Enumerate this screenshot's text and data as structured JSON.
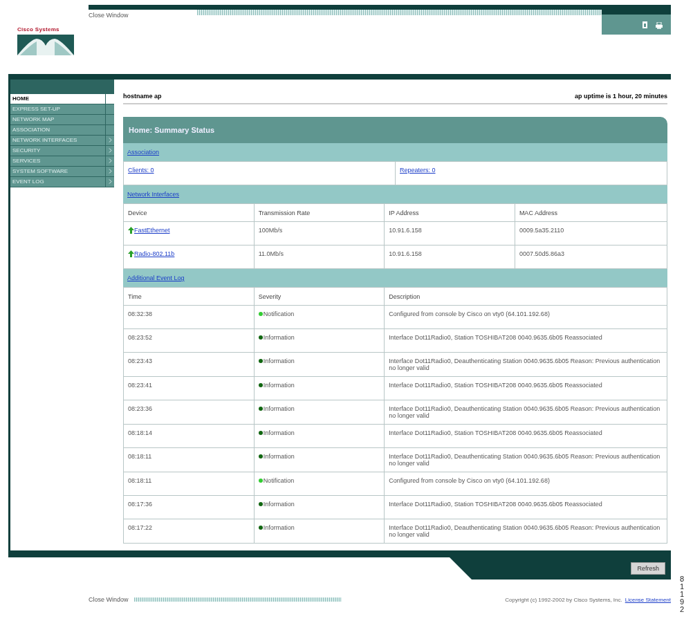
{
  "header": {
    "close_window": "Close Window",
    "brand": "Cisco Systems"
  },
  "sidebar": [
    {
      "label": "HOME",
      "selected": true,
      "has_submenu": false
    },
    {
      "label": "EXPRESS SET-UP",
      "selected": false,
      "has_submenu": false
    },
    {
      "label": "NETWORK MAP",
      "selected": false,
      "has_submenu": false
    },
    {
      "label": "ASSOCIATION",
      "selected": false,
      "has_submenu": false
    },
    {
      "label": "NETWORK INTERFACES",
      "selected": false,
      "has_submenu": true
    },
    {
      "label": "SECURITY",
      "selected": false,
      "has_submenu": true
    },
    {
      "label": "SERVICES",
      "selected": false,
      "has_submenu": true
    },
    {
      "label": "SYSTEM SOFTWARE",
      "selected": false,
      "has_submenu": true
    },
    {
      "label": "EVENT LOG",
      "selected": false,
      "has_submenu": true
    }
  ],
  "status": {
    "hostname": "hostname ap",
    "uptime": "ap uptime is 1 hour, 20 minutes"
  },
  "panel": {
    "title": "Home: Summary Status",
    "association": {
      "link": "Association",
      "cells": [
        "Clients: 0",
        "Repeaters: 0"
      ]
    },
    "interfaces": {
      "link": "Network Interfaces",
      "columns": [
        "Device",
        "Transmission Rate",
        "IP Address",
        "MAC Address"
      ],
      "rows": [
        {
          "device": "FastEthernet",
          "up": true,
          "rate": "100Mb/s",
          "ip": "10.91.6.158",
          "mac": "0009.5a35.2110"
        },
        {
          "device": "Radio-802.11b",
          "up": true,
          "rate": "11.0Mb/s",
          "ip": "10.91.6.158",
          "mac": "0007.50d5.86a3"
        }
      ]
    },
    "events": {
      "link": "Additional Event Log",
      "columns": [
        "Time",
        "Severity",
        "Description"
      ],
      "rows": [
        {
          "time": "08:32:38",
          "severity": "Notification",
          "color": "#33cc33",
          "description": "Configured from console by Cisco on vty0 (64.101.192.68)"
        },
        {
          "time": "08:23:52",
          "severity": "Information",
          "color": "#116611",
          "description": "Interface Dot11Radio0, Station TOSHIBAT208 0040.9635.6b05 Reassociated"
        },
        {
          "time": "08:23:43",
          "severity": "Information",
          "color": "#116611",
          "description": "Interface Dot11Radio0, Deauthenticating Station 0040.9635.6b05 Reason: Previous authentication no longer valid"
        },
        {
          "time": "08:23:41",
          "severity": "Information",
          "color": "#116611",
          "description": "Interface Dot11Radio0, Station TOSHIBAT208 0040.9635.6b05 Reassociated"
        },
        {
          "time": "08:23:36",
          "severity": "Information",
          "color": "#116611",
          "description": "Interface Dot11Radio0, Deauthenticating Station 0040.9635.6b05 Reason: Previous authentication no longer valid"
        },
        {
          "time": "08:18:14",
          "severity": "Information",
          "color": "#116611",
          "description": "Interface Dot11Radio0, Station TOSHIBAT208 0040.9635.6b05 Reassociated"
        },
        {
          "time": "08:18:11",
          "severity": "Information",
          "color": "#116611",
          "description": "Interface Dot11Radio0, Deauthenticating Station 0040.9635.6b05 Reason: Previous authentication no longer valid"
        },
        {
          "time": "08:18:11",
          "severity": "Notification",
          "color": "#33cc33",
          "description": "Configured from console by Cisco on vty0 (64.101.192.68)"
        },
        {
          "time": "08:17:36",
          "severity": "Information",
          "color": "#116611",
          "description": "Interface Dot11Radio0, Station TOSHIBAT208 0040.9635.6b05 Reassociated"
        },
        {
          "time": "08:17:22",
          "severity": "Information",
          "color": "#116611",
          "description": "Interface Dot11Radio0, Deauthenticating Station 0040.9635.6b05 Reason: Previous authentication no longer valid"
        }
      ]
    }
  },
  "refresh_button": "Refresh",
  "footer": {
    "close_window": "Close Window",
    "copyright": "Copyright (c) 1992-2002 by Cisco Systems, Inc.",
    "license_link": "License Statement"
  },
  "figure_number": "81192"
}
